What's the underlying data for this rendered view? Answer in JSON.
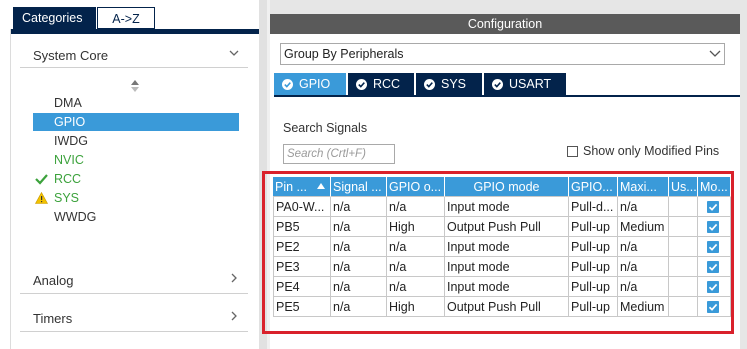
{
  "left_panel": {
    "tabs": [
      {
        "label": "Categories",
        "active": true
      },
      {
        "label": "A->Z",
        "active": false
      }
    ],
    "categories": [
      {
        "label": "System Core",
        "expanded": true
      },
      {
        "label": "Analog",
        "expanded": false
      },
      {
        "label": "Timers",
        "expanded": false
      }
    ],
    "system_core_items": [
      {
        "label": "DMA",
        "status": "none"
      },
      {
        "label": "GPIO",
        "status": "selected"
      },
      {
        "label": "IWDG",
        "status": "none"
      },
      {
        "label": "NVIC",
        "status": "green"
      },
      {
        "label": "RCC",
        "status": "check"
      },
      {
        "label": "SYS",
        "status": "warning"
      },
      {
        "label": "WWDG",
        "status": "none"
      }
    ]
  },
  "configuration": {
    "title": "Configuration",
    "group_select": "Group By Peripherals",
    "tabs": [
      {
        "label": "GPIO",
        "active": true
      },
      {
        "label": "RCC",
        "active": false
      },
      {
        "label": "SYS",
        "active": false
      },
      {
        "label": "USART",
        "active": false
      }
    ],
    "search_label": "Search Signals",
    "search_placeholder": "Search (Crtl+F)",
    "only_modified_label": "Show only Modified Pins",
    "only_modified_checked": false
  },
  "table": {
    "headers": [
      "Pin ...",
      "Signal ...",
      "GPIO o...",
      "GPIO mode",
      "GPIO...",
      "Maxi...",
      "Us...",
      "Mo..."
    ],
    "rows": [
      [
        "PA0-W...",
        "n/a",
        "n/a",
        "Input mode",
        "Pull-d...",
        "n/a",
        "",
        true
      ],
      [
        "PB5",
        "n/a",
        "High",
        "Output Push Pull",
        "Pull-up",
        "Medium",
        "",
        true
      ],
      [
        "PE2",
        "n/a",
        "n/a",
        "Input mode",
        "Pull-up",
        "n/a",
        "",
        true
      ],
      [
        "PE3",
        "n/a",
        "n/a",
        "Input mode",
        "Pull-up",
        "n/a",
        "",
        true
      ],
      [
        "PE4",
        "n/a",
        "n/a",
        "Input mode",
        "Pull-up",
        "n/a",
        "",
        true
      ],
      [
        "PE5",
        "n/a",
        "High",
        "Output Push Pull",
        "Pull-up",
        "Medium",
        "",
        true
      ]
    ]
  },
  "colors": {
    "navy": "#03234b",
    "accent": "#3a9ad9",
    "highlight_border": "#d9212b",
    "ok_green": "#3ca23c",
    "warning_yellow": "#f2c200"
  }
}
